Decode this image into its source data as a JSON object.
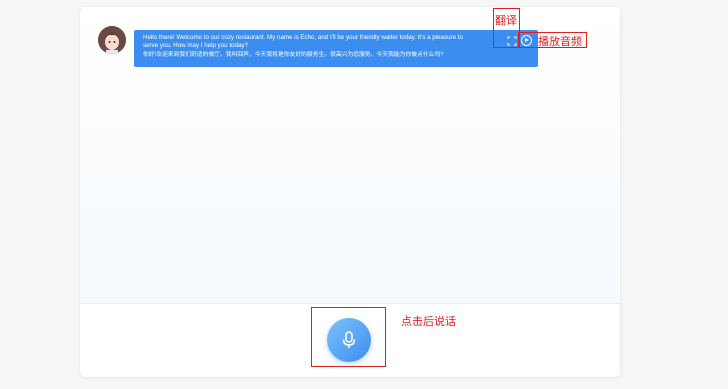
{
  "chat": {
    "messages": [
      {
        "role": "assistant",
        "text_en_line1": "Hello there! Welcome to our cozy restaurant. My name is Echo, and I'll be your friendly waiter today. It's a pleasure to",
        "text_en_line2": "serve you. How may I help you today?",
        "text_zh": "你好!欢迎来到我们舒适的餐厅。我叫回声，今天我将是你友好的服务生。很高兴为您服务。今天我能为你做点什么吗?"
      }
    ],
    "icons": {
      "avatar": "avatar-icon",
      "translate": "translate-icon",
      "play": "play-circle-icon",
      "mic": "microphone-icon"
    }
  },
  "annotations": {
    "translate_label": "翻译",
    "play_label": "播放音频",
    "mic_label": "点击后说话"
  },
  "colors": {
    "bubble": "#3b8df0",
    "annotation": "#e02020",
    "mic_start": "#7cc1fb",
    "mic_end": "#3c8ff0"
  }
}
